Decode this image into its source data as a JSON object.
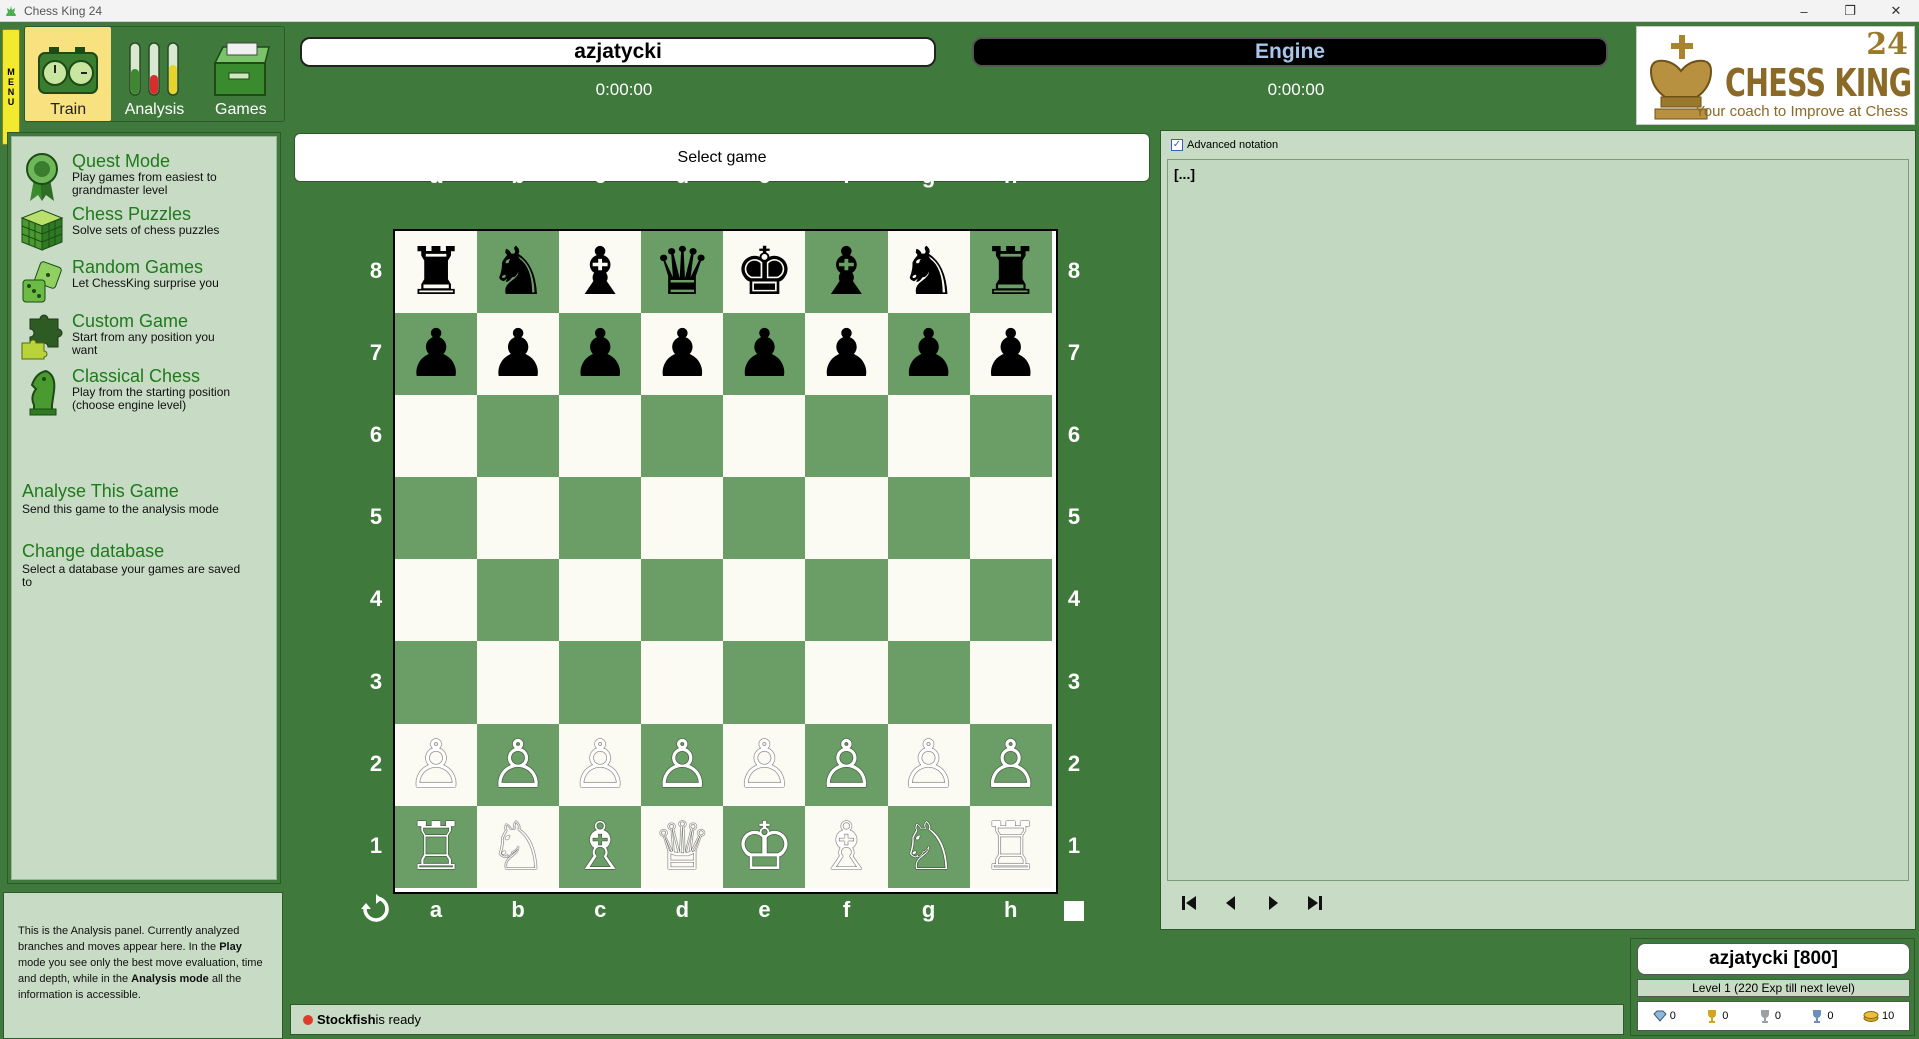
{
  "window": {
    "title": "Chess King 24",
    "minimize": "–",
    "maximize": "❐",
    "close": "✕"
  },
  "toolbar": {
    "menu_letters": [
      "M",
      "E",
      "N",
      "U"
    ],
    "tools": [
      {
        "label": "Train",
        "icon": "train-clock-icon",
        "active": true
      },
      {
        "label": "Analysis",
        "icon": "analysis-tubes-icon",
        "active": false
      },
      {
        "label": "Games",
        "icon": "games-drawer-icon",
        "active": false
      }
    ]
  },
  "players": {
    "white": {
      "name": "azjatycki",
      "clock": "0:00:00"
    },
    "black": {
      "name": "Engine",
      "clock": "0:00:00"
    }
  },
  "logo": {
    "version": "24",
    "name": "CHESS KING",
    "tagline": "Your coach to Improve at Chess"
  },
  "menu": {
    "items": [
      {
        "title": "Quest Mode",
        "desc": "Play games from easiest to grandmaster level",
        "icon": "medal-icon"
      },
      {
        "title": "Chess Puzzles",
        "desc": "Solve sets of chess puzzles",
        "icon": "cube-icon"
      },
      {
        "title": "Random Games",
        "desc": "Let ChessKing surprise you",
        "icon": "dice-icon"
      },
      {
        "title": "Custom Game",
        "desc": "Start from any position you want",
        "icon": "puzzle-icon"
      },
      {
        "title": "Classical Chess",
        "desc": "Play from the starting position (choose engine level)",
        "icon": "knight-icon"
      }
    ],
    "text_items": [
      {
        "title": "Analyse This Game",
        "desc": "Send this game to the analysis mode"
      },
      {
        "title": "Change database",
        "desc": "Select a database your games are saved to"
      }
    ]
  },
  "info": {
    "p1": "This is the Analysis panel. Currently analyzed branches and moves appear here. In the ",
    "b1": "Play",
    "p2": " mode you see only the best move evaluation, time and depth, while in the ",
    "b2": "Analysis mode",
    "p3": " all the information is accessible."
  },
  "select_game": "Select game",
  "board": {
    "files": [
      "a",
      "b",
      "c",
      "d",
      "e",
      "f",
      "g",
      "h"
    ],
    "ranks": [
      "8",
      "7",
      "6",
      "5",
      "4",
      "3",
      "2",
      "1"
    ],
    "position": [
      [
        "♜",
        "♞",
        "♝",
        "♛",
        "♚",
        "♝",
        "♞",
        "♜"
      ],
      [
        "♟",
        "♟",
        "♟",
        "♟",
        "♟",
        "♟",
        "♟",
        "♟"
      ],
      [
        "",
        "",
        "",
        "",
        "",
        "",
        "",
        ""
      ],
      [
        "",
        "",
        "",
        "",
        "",
        "",
        "",
        ""
      ],
      [
        "",
        "",
        "",
        "",
        "",
        "",
        "",
        ""
      ],
      [
        "",
        "",
        "",
        "",
        "",
        "",
        "",
        ""
      ],
      [
        "♙",
        "♙",
        "♙",
        "♙",
        "♙",
        "♙",
        "♙",
        "♙"
      ],
      [
        "♖",
        "♘",
        "♗",
        "♕",
        "♔",
        "♗",
        "♘",
        "♖"
      ]
    ],
    "colors": {
      "light": "#fbfbf3",
      "dark": "#6b9e66"
    }
  },
  "notation": {
    "advanced_label": "Advanced notation",
    "advanced_checked": true,
    "text": "[...]"
  },
  "profile": {
    "name": "azjatycki [800]",
    "level": "Level 1 (220 Exp till next level)",
    "stats": [
      {
        "icon": "diamond-icon",
        "value": "0"
      },
      {
        "icon": "gold-trophy-icon",
        "value": "0"
      },
      {
        "icon": "silver-trophy-icon",
        "value": "0"
      },
      {
        "icon": "blue-trophy-icon",
        "value": "0"
      },
      {
        "icon": "coins-icon",
        "value": "10"
      }
    ]
  },
  "status": {
    "engine": "Stockfish",
    "text": " is ready"
  }
}
